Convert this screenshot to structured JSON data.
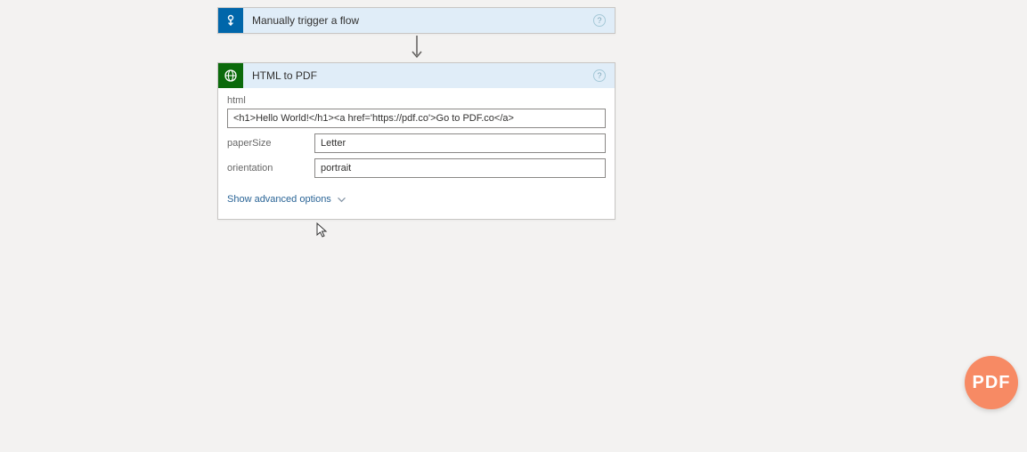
{
  "trigger": {
    "title": "Manually trigger a flow"
  },
  "action": {
    "title": "HTML to PDF",
    "fields": {
      "html": {
        "label": "html",
        "value": "<h1>Hello World!</h1><a href='https://pdf.co'>Go to PDF.co</a>"
      },
      "paperSize": {
        "label": "paperSize",
        "value": "Letter"
      },
      "orientation": {
        "label": "orientation",
        "value": "portrait"
      }
    },
    "advanced": "Show advanced options"
  },
  "badge": {
    "text": "PDF"
  }
}
